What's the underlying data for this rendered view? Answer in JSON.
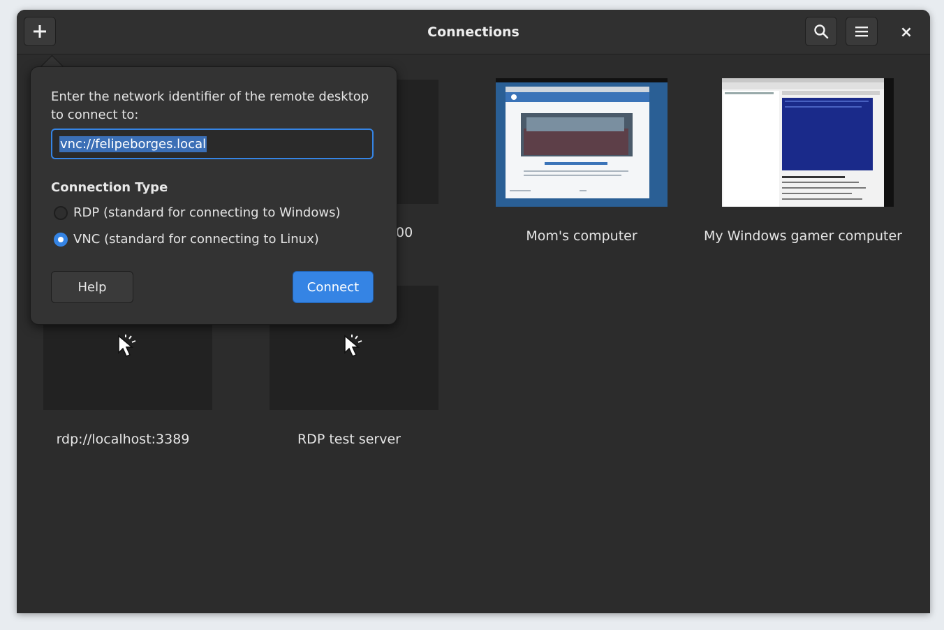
{
  "window": {
    "title": "Connections"
  },
  "header": {
    "new_icon": "plus-icon",
    "search_icon": "search-icon",
    "menu_icon": "menu-icon",
    "close_label": "×"
  },
  "connections": [
    {
      "label": "rdp://localhost:3389",
      "thumbnail": "cursor-icon"
    },
    {
      "label": "RDP test server",
      "thumbnail": "cursor-icon"
    },
    {
      "label": "Mom's computer",
      "thumbnail": "screenshot"
    },
    {
      "label": "My Windows gamer computer",
      "thumbnail": "screenshot"
    }
  ],
  "partial_label": "00",
  "popover": {
    "prompt": "Enter the network identifier of the remote desktop to connect to:",
    "url_value": "vnc://felipeborges.local",
    "type_heading": "Connection Type",
    "options": [
      {
        "label": "RDP (standard for connecting to Windows)",
        "selected": false
      },
      {
        "label": "VNC (standard for connecting to Linux)",
        "selected": true
      }
    ],
    "help_label": "Help",
    "connect_label": "Connect"
  },
  "colors": {
    "accent": "#3584e4",
    "background": "#2c2c2c"
  }
}
